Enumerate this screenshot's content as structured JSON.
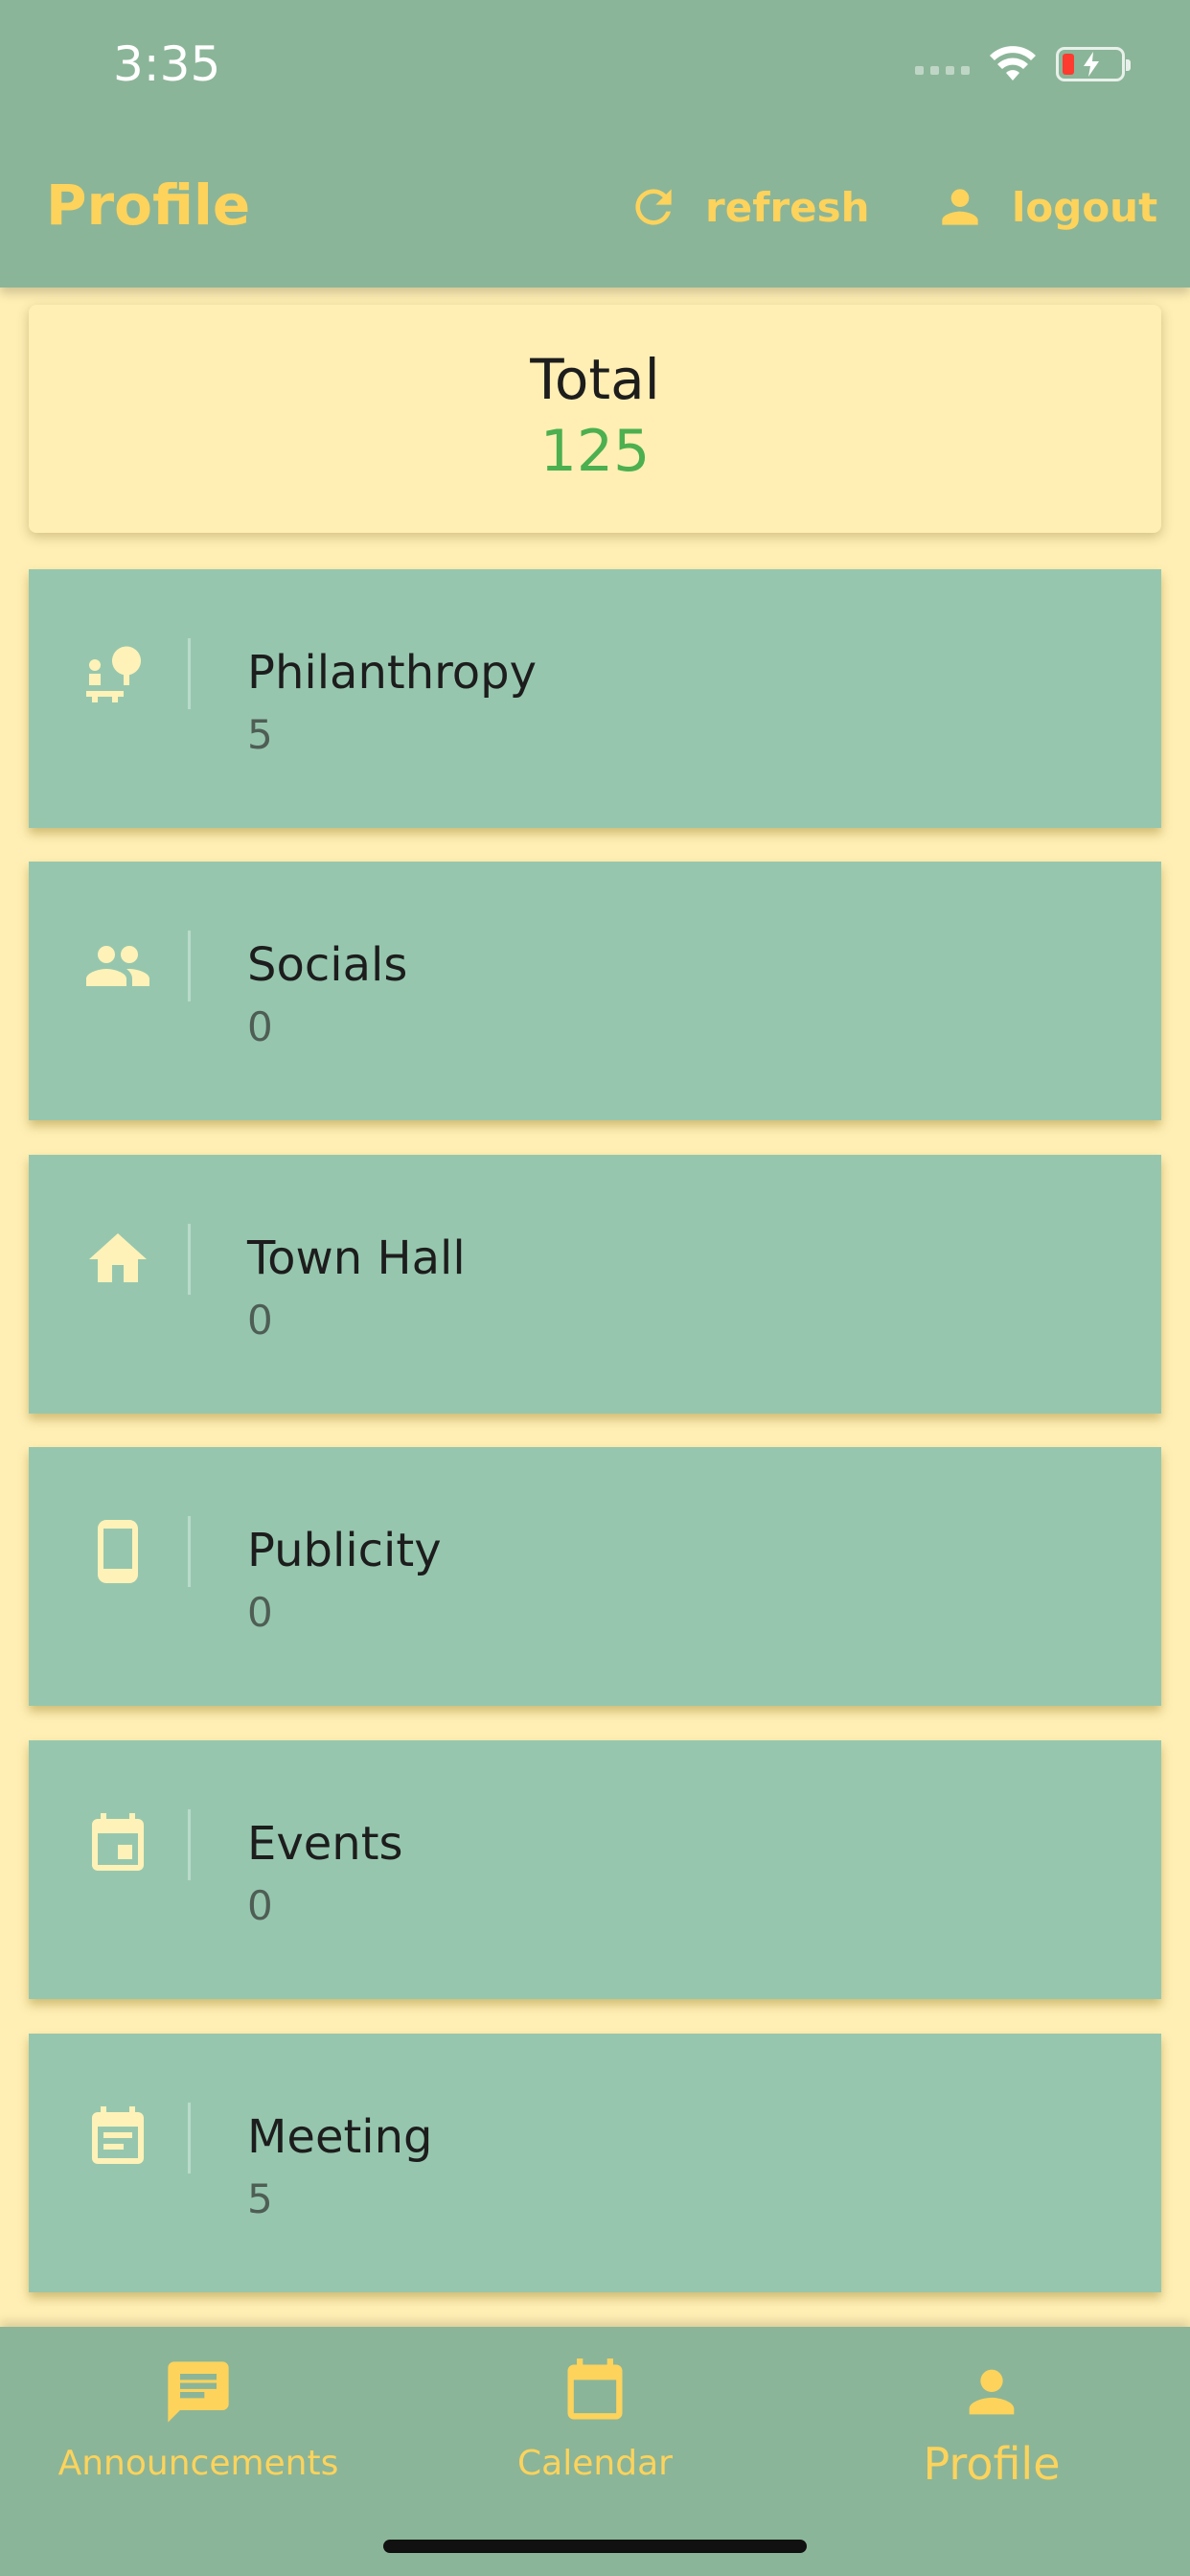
{
  "status_bar": {
    "time": "3:35"
  },
  "header": {
    "title": "Profile",
    "refresh_label": "refresh",
    "logout_label": "logout"
  },
  "total": {
    "label": "Total",
    "value": "125"
  },
  "categories": [
    {
      "label": "Philanthropy",
      "count": "5",
      "icon": "philanthropy-icon"
    },
    {
      "label": "Socials",
      "count": "0",
      "icon": "people-icon"
    },
    {
      "label": "Town Hall",
      "count": "0",
      "icon": "home-icon"
    },
    {
      "label": "Publicity",
      "count": "0",
      "icon": "phone-icon"
    },
    {
      "label": "Events",
      "count": "0",
      "icon": "calendar-event-icon"
    },
    {
      "label": "Meeting",
      "count": "5",
      "icon": "calendar-note-icon"
    }
  ],
  "bottom_nav": {
    "items": [
      {
        "label": "Announcements",
        "icon": "chat-icon",
        "active": false
      },
      {
        "label": "Calendar",
        "icon": "calendar-icon",
        "active": false
      },
      {
        "label": "Profile",
        "icon": "person-icon",
        "active": true
      }
    ]
  },
  "colors": {
    "header_bg": "#8bb598",
    "accent_yellow": "#fdd35c",
    "card_green": "#96c7ae",
    "background_cream": "#ffefb4",
    "total_value_green": "#4caf50"
  }
}
